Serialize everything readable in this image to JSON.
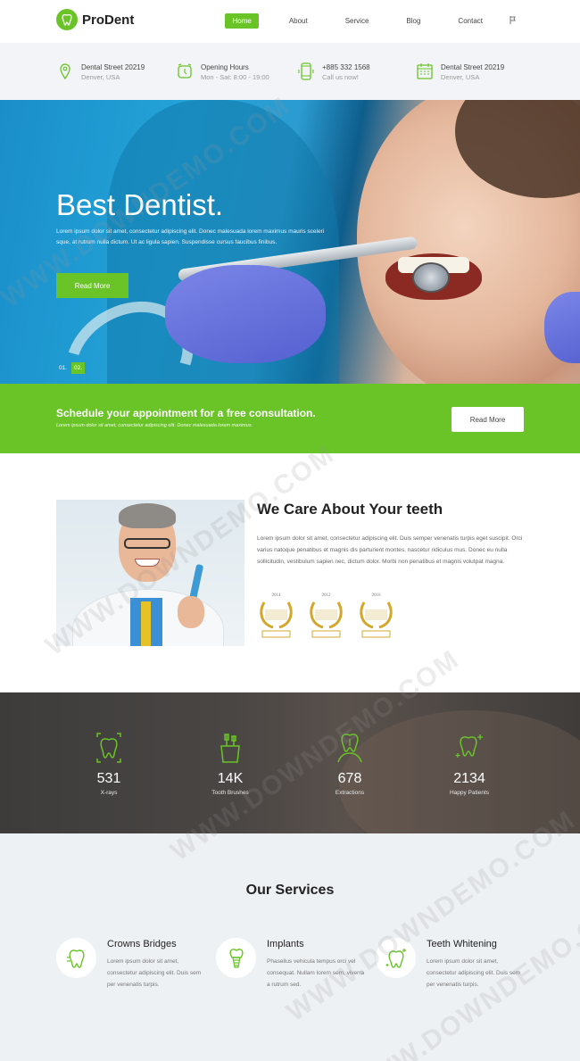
{
  "brand": {
    "name": "ProDent",
    "accent": "#6ac427"
  },
  "nav": {
    "items": [
      "Home",
      "About",
      "Service",
      "Blog",
      "Contact"
    ],
    "active": "Home",
    "lang_flag": "flag-icon"
  },
  "infobar": [
    {
      "icon": "map-pin-icon",
      "title": "Dental Street 20219",
      "sub": "Denver, USA"
    },
    {
      "icon": "alarm-clock-icon",
      "title": "Opening Hours",
      "sub": "Mon - Sat: 8:00 - 19:00"
    },
    {
      "icon": "phone-icon",
      "title": "+885 332 1568",
      "sub": "Call us now!"
    },
    {
      "icon": "calendar-icon",
      "title": "Dental Street 20219",
      "sub": "Denver, USA"
    }
  ],
  "hero": {
    "title": "Best Dentist.",
    "text": "Lorem ipsum dolor sit amet, consectetur adipiscing elit. Donec malesuada lorem maximus mauris sceleri sque, at rutrum nulla dictum. Ut ac ligula sapien. Suspendisse cursus faucibus finibus.",
    "button": "Read More",
    "slides": [
      "01.",
      "02."
    ],
    "active_slide": "02."
  },
  "cta": {
    "title": "Schedule your appointment for a free consultation.",
    "subtitle": "Lorem ipsum dolor sit amet, consectetur adipiscing elit. Donec malesuada lorem maximus.",
    "button": "Read More"
  },
  "about": {
    "title": "We Care About Your teeth",
    "text": "Lorem ipsum dolor sit amet, consectetur adipiscing elit. Duis semper venenatis turpis eget suscipit. Orci varius natoque penatibus et magnis dis parturient montes, nascetur ridiculus mus. Donec eu nulla sollicitudin, vestibulum sapien nec, dictum dolor. Morbi non penatibus et magnis volutpat magna.",
    "awards": [
      "2014",
      "2012",
      "2016"
    ]
  },
  "stats": [
    {
      "icon": "tooth-xray-icon",
      "value": "531",
      "label": "X-rays"
    },
    {
      "icon": "toothbrush-cup-icon",
      "value": "14K",
      "label": "Tooth Brushes"
    },
    {
      "icon": "tooth-extraction-icon",
      "value": "678",
      "label": "Extractions"
    },
    {
      "icon": "sparkling-tooth-icon",
      "value": "2134",
      "label": "Happy Patients"
    }
  ],
  "services": {
    "title": "Our Services",
    "items": [
      {
        "icon": "tooth-crown-icon",
        "title": "Crowns Bridges",
        "text": "Lorem ipsum dolor sit amet, consectetur adipiscing elit. Duis sem per venenatis turpis."
      },
      {
        "icon": "tooth-implant-icon",
        "title": "Implants",
        "text": "Phasellus vehicula tempus orci vel consequat. Nullam lorem sem, viverra a rutrum sed."
      },
      {
        "icon": "tooth-whitening-icon",
        "title": "Teeth Whitening",
        "text": "Lorem ipsum dolor sit amet, consectetur adipiscing elit. Duis sem per venenatis turpis."
      }
    ]
  },
  "watermark": "WWW.DOWNDEMO.COM"
}
